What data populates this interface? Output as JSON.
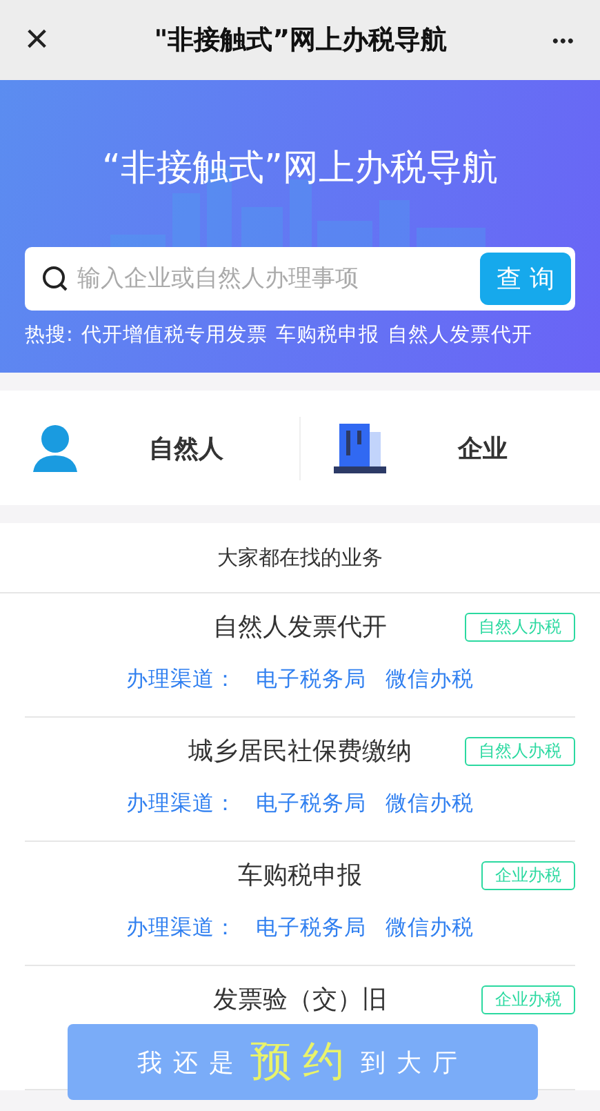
{
  "nav": {
    "close": "×",
    "title": "\"非接触式”网上办税导航",
    "more": "•••"
  },
  "banner": {
    "title": "“非接触式”网上办税导航",
    "search": {
      "placeholder": "输入企业或自然人办理事项",
      "button": "查 询"
    },
    "hot_label": "热搜:",
    "hot": [
      "代开增值税专用发票",
      "车购税申报",
      "自然人发票代开"
    ]
  },
  "categories": [
    {
      "kind": "person",
      "label": "自然人"
    },
    {
      "kind": "company",
      "label": "企业"
    }
  ],
  "popular": {
    "title": "大家都在找的业务",
    "items": [
      {
        "name": "自然人发票代开",
        "tag": "自然人办税",
        "channel_label": "办理渠道：",
        "channels": [
          "电子税务局",
          "微信办税"
        ]
      },
      {
        "name": "城乡居民社保费缴纳",
        "tag": "自然人办税",
        "channel_label": "办理渠道：",
        "channels": [
          "电子税务局",
          "微信办税"
        ]
      },
      {
        "name": "车购税申报",
        "tag": "企业办税",
        "channel_label": "办理渠道：",
        "channels": [
          "电子税务局",
          "微信办税"
        ]
      },
      {
        "name": "发票验（交）旧",
        "tag": "企业办税"
      }
    ]
  },
  "appointment": {
    "before": "我还是",
    "highlight": "预约",
    "after": "到大厅"
  }
}
